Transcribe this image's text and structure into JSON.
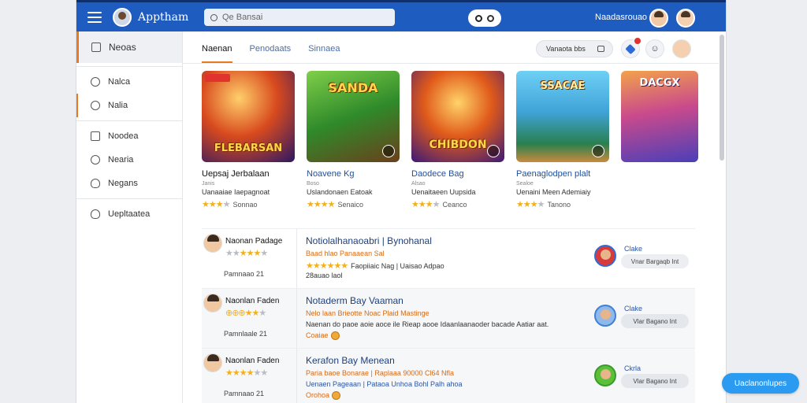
{
  "header": {
    "app_name": "Apptham",
    "search_placeholder": "Qe Bansai",
    "user_name": "Naadasrouao",
    "icons": [
      "menu-icon",
      "search-icon",
      "settings-ring-icon"
    ]
  },
  "sidebar": {
    "items": [
      {
        "label": "Neoas",
        "icon": "square-icon"
      },
      {
        "label": "Nalca",
        "icon": "circle-icon"
      },
      {
        "label": "Nalia",
        "icon": "circle-icon"
      },
      {
        "label": "Noodea",
        "icon": "square-icon"
      },
      {
        "label": "Nearia",
        "icon": "circle-icon"
      },
      {
        "label": "Negans",
        "icon": "heart-icon"
      },
      {
        "label": "Uepltaatea",
        "icon": "heart-icon"
      }
    ]
  },
  "main": {
    "tabs": [
      "Naenan",
      "Penodaats",
      "Sinnaea"
    ],
    "filter_label": "Vanaota bbs"
  },
  "cards": [
    {
      "title": "Uepsaj Jerbalaan",
      "sub": "Uanaaiae Iaepagnoat",
      "rating": "Sonnao",
      "tiny": "Janis",
      "logo": "FLEBARSAN"
    },
    {
      "title": "Noavene Kg",
      "sub": "Uslandonaen Eatoak",
      "rating": "Senaico",
      "tiny": "Boso",
      "logo": "SANDA"
    },
    {
      "title": "Daodece Bag",
      "sub": "Uenaitaeen Uupsida",
      "rating": "Ceanco",
      "tiny": "Alsao",
      "logo": "CHIBDON"
    },
    {
      "title": "Paenaglodpen plalt",
      "sub": "Uenaini Meen Ademiaiy",
      "rating": "Tanono",
      "tiny": "Sealoe",
      "logo": "SSACAE"
    },
    {
      "title": "",
      "sub": "",
      "rating": "",
      "tiny": "",
      "logo": "DACGX"
    }
  ],
  "reviews": [
    {
      "name": "Naonan Padage",
      "meta": "Pamnaao 21",
      "title": "Notiolalhanaoabri | Bynohanal",
      "line1": "Baad hlao Panaaean Sal",
      "line2": "Faopiiaic Nag | Uaisao Adpao",
      "line3": "28auao laol",
      "reply_name": "Clake",
      "reply_label": "Vnar Bargaqb Int"
    },
    {
      "name": "Naonlan Faden",
      "meta": "Pamnlaale 21",
      "title": "Notaderm Bay Vaaman",
      "line1": "Nelo laan Brieotte Noac Plaid Mastinge",
      "line2": "Naenan do paoe aoie aoce ile Rieap aooe Idaanlaanaoder bacade Aatiar aat.",
      "line3": "Coaiae",
      "reply_name": "Clake",
      "reply_label": "Vlar Bagano Int"
    },
    {
      "name": "Naonlan Faden",
      "meta": "Pamnaao 21",
      "title": "Kerafon Bay Menean",
      "line1": "Paria baoe Bonarae | Raplaaa 90000 Cl64 Nfla",
      "line2": "Uenaen Pageaan | Pataoa Unhoa Bohl Palh ahoa",
      "line3": "Orohoa",
      "reply_name": "Ckrla",
      "reply_label": "Vlar Bagano Int"
    }
  ],
  "fab_label": "Uaclanonlupes",
  "colors": {
    "header": "#1f5cc0",
    "accent": "#e57a23",
    "star": "#f2b01e",
    "fab": "#2a9bf0"
  },
  "ratings": {
    "reviews": [
      4,
      3,
      3.5
    ],
    "cards": [
      3,
      3.5,
      3,
      3
    ]
  }
}
